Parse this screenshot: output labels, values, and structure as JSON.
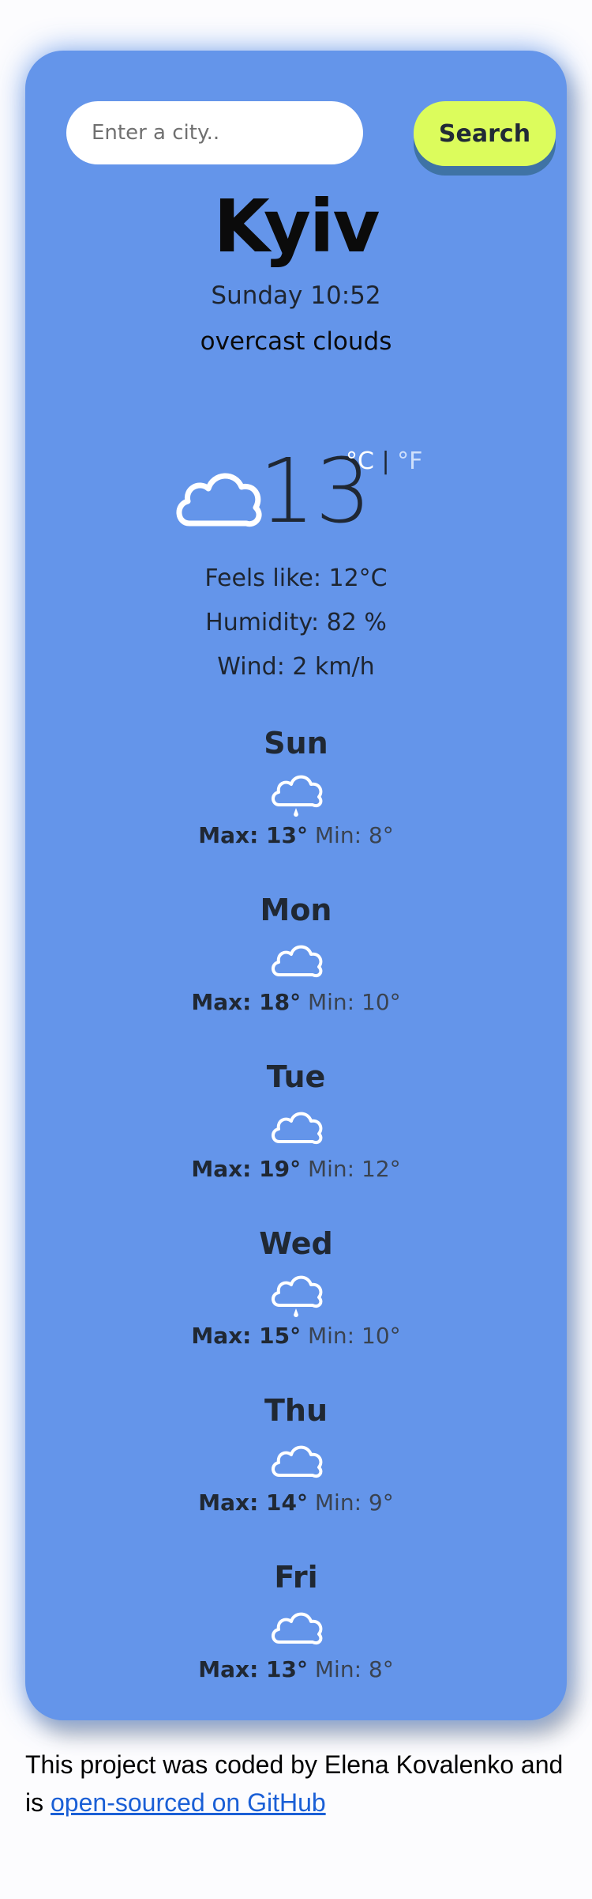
{
  "search": {
    "placeholder": "Enter a city..",
    "button_label": "Search"
  },
  "current": {
    "city": "Kyiv",
    "datetime": "Sunday 10:52",
    "description": "overcast clouds",
    "icon": "cloud-icon",
    "temperature": "13",
    "unit_celsius": "°C",
    "unit_separator": "|",
    "unit_fahrenheit": "°F",
    "feels_like": "Feels like: 12°C",
    "humidity": "Humidity: 82 %",
    "wind": "Wind: 2 km/h"
  },
  "forecast": [
    {
      "day": "Sun",
      "icon": "rain-cloud-icon",
      "max": "Max: 13°",
      "min": "Min: 8°"
    },
    {
      "day": "Mon",
      "icon": "cloud-icon",
      "max": "Max: 18°",
      "min": "Min: 10°"
    },
    {
      "day": "Tue",
      "icon": "cloud-icon",
      "max": "Max: 19°",
      "min": "Min: 12°"
    },
    {
      "day": "Wed",
      "icon": "rain-cloud-icon",
      "max": "Max: 15°",
      "min": "Min: 10°"
    },
    {
      "day": "Thu",
      "icon": "cloud-icon",
      "max": "Max: 14°",
      "min": "Min: 9°"
    },
    {
      "day": "Fri",
      "icon": "cloud-icon",
      "max": "Max: 13°",
      "min": "Min: 8°"
    }
  ],
  "footer": {
    "text_before": "This project was coded by Elena Kovalenko and is",
    "link_text": "open-sourced on GitHub"
  },
  "colors": {
    "card_background": "#6495ea",
    "search_button": "#dcfc5c",
    "link": "#1a5fd6"
  }
}
